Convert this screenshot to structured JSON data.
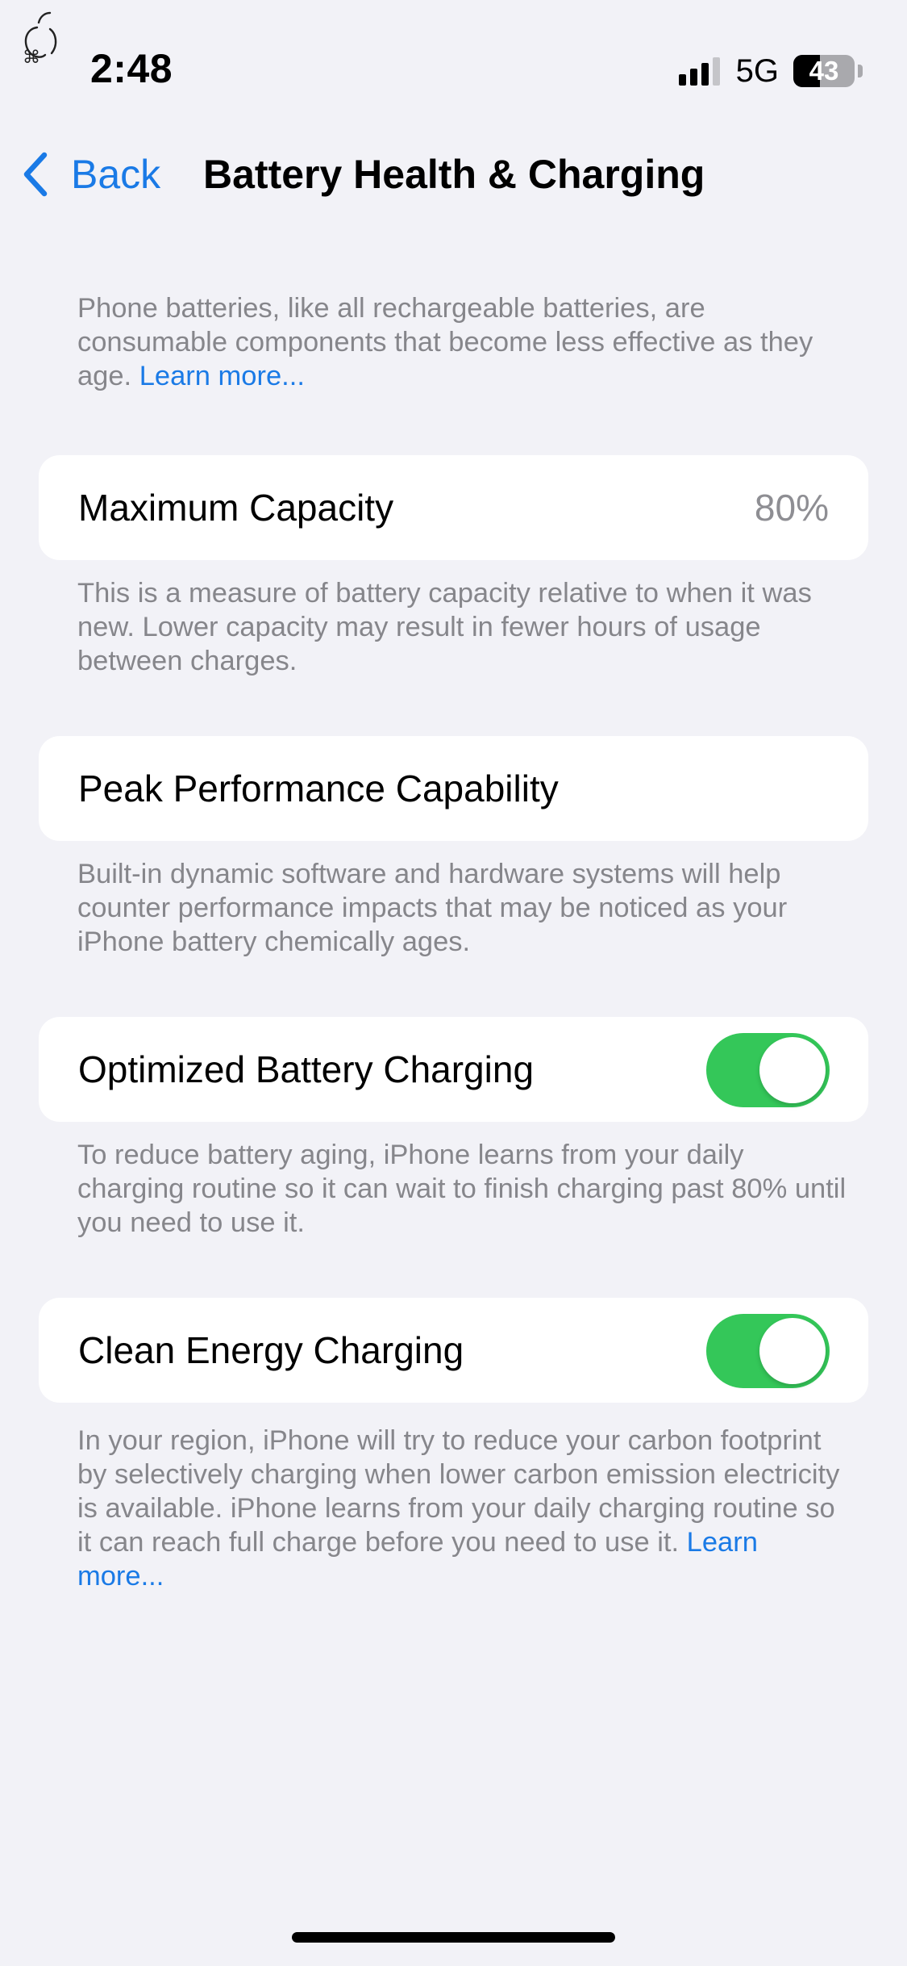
{
  "colors": {
    "background": "#f2f2f7",
    "card": "#ffffff",
    "accent": "#1a7ae6",
    "secondary_text": "#86868b",
    "toggle_on": "#34c759"
  },
  "status_bar": {
    "time": "2:48",
    "network": "5G",
    "battery_level": "43",
    "battery_fraction": 0.43,
    "signal_bars_active": 3,
    "signal_bars_total": 4
  },
  "nav": {
    "back_label": "Back",
    "back_icon": "chevron-left-icon",
    "title": "Battery Health & Charging"
  },
  "intro": {
    "text": "Phone batteries, like all rechargeable batteries, are consumable components that become less effective as they age. ",
    "link": "Learn more..."
  },
  "maximum_capacity": {
    "label": "Maximum Capacity",
    "value": "80%",
    "footnote": "This is a measure of battery capacity relative to when it was new. Lower capacity may result in fewer hours of usage between charges."
  },
  "peak_performance": {
    "label": "Peak Performance Capability",
    "footnote": "Built-in dynamic software and hardware systems will help counter performance impacts that may be noticed as your iPhone battery chemically ages."
  },
  "optimized_charging": {
    "label": "Optimized Battery Charging",
    "enabled": true,
    "footnote": "To reduce battery aging, iPhone learns from your daily charging routine so it can wait to finish charging past 80% until you need to use it."
  },
  "clean_energy": {
    "label": "Clean Energy Charging",
    "enabled": true,
    "footnote": "In your region, iPhone will try to reduce your carbon footprint by selectively charging when lower carbon emission electricity is available. iPhone learns from your daily charging routine so it can reach full charge before you need to use it. ",
    "link": "Learn more..."
  }
}
